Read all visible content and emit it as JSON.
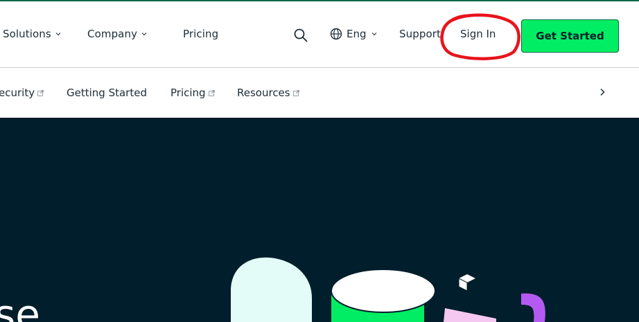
{
  "header": {
    "nav": [
      {
        "label": "Solutions",
        "has_dropdown": true
      },
      {
        "label": "Company",
        "has_dropdown": true
      },
      {
        "label": "Pricing",
        "has_dropdown": false
      }
    ],
    "search_icon": "search-icon",
    "language": {
      "label": "Eng",
      "icon": "globe-icon"
    },
    "support_label": "Support",
    "signin_label": "Sign In",
    "cta_label": "Get Started"
  },
  "subnav": {
    "items": [
      {
        "label": "ecurity",
        "external": true
      },
      {
        "label": "Getting Started",
        "external": false
      },
      {
        "label": "Pricing",
        "external": true
      },
      {
        "label": "Resources",
        "external": true
      }
    ],
    "next_icon": "chevron-right-icon"
  },
  "hero": {
    "partial_text": "se"
  },
  "colors": {
    "accent": "#00ed64",
    "brand_dark": "#001e2b",
    "brand_green": "#00684a",
    "annotation": "#e8141c"
  }
}
